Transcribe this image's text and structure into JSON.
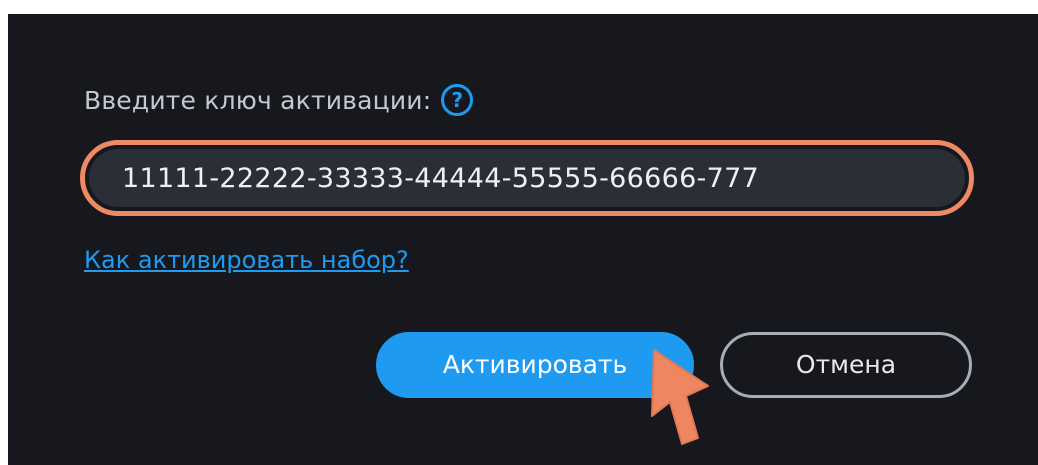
{
  "dialog": {
    "prompt_label": "Введите ключ активации:",
    "help_icon_glyph": "?",
    "key_input_value": "11111-22222-33333-44444-55555-66666-777",
    "help_link": "Как активировать набор?",
    "activate_button": "Активировать",
    "cancel_button": "Отмена"
  },
  "icons": {
    "help": "question-circle-icon",
    "cursor": "hand-pointer-icon"
  },
  "colors": {
    "dialog_background": "#16181d",
    "input_background": "#2a2e36",
    "input_highlight": "#ed8a63",
    "accent": "#1e9bf0",
    "cancel_border": "#a8acb4",
    "cursor_fill": "#ee8660"
  }
}
